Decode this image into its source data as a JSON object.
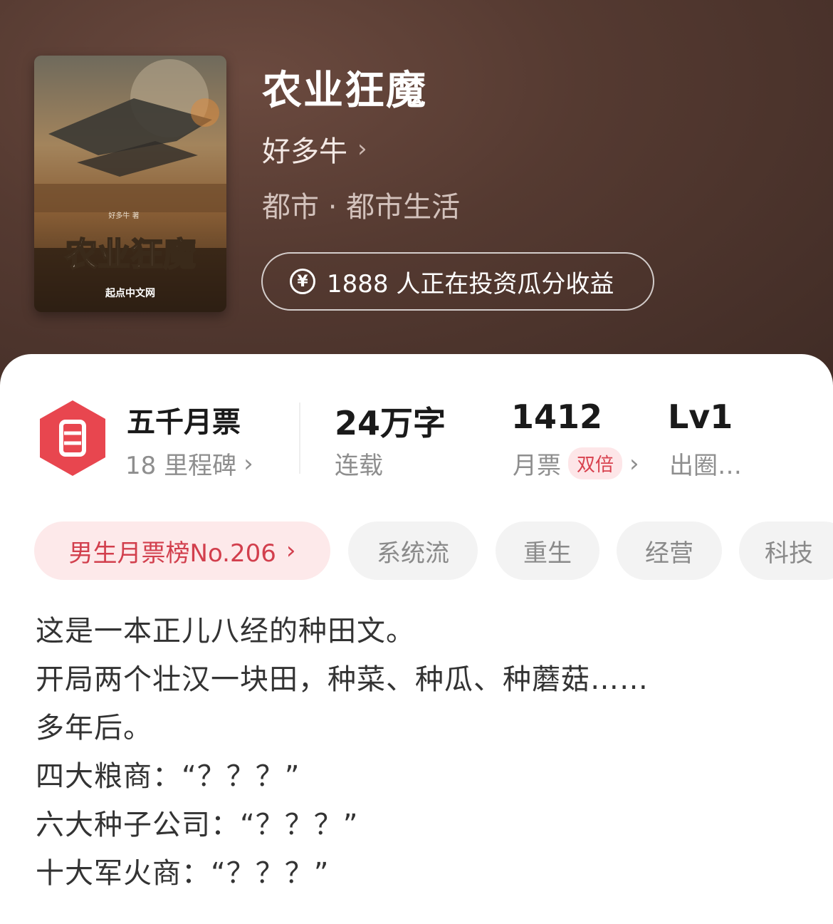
{
  "book": {
    "title": "农业狂魔",
    "author": "好多牛",
    "genre": "都市 · 都市生活",
    "invest_text": "1888 人正在投资瓜分收益",
    "cover": {
      "title": "农业狂魔",
      "author_tag": "好多牛 著",
      "publisher": "起点中文网"
    }
  },
  "stats": {
    "badge": {
      "title": "五千月票",
      "sub": "18 里程碑"
    },
    "words": {
      "title": "24万字",
      "sub": "连载"
    },
    "tickets": {
      "title": "1412",
      "sub": "月票",
      "double": "双倍"
    },
    "level": {
      "title": "Lv1",
      "sub": "出圈…"
    }
  },
  "tags": {
    "rank": "男生月票榜No.206",
    "items": [
      "系统流",
      "重生",
      "经营",
      "科技"
    ]
  },
  "description": [
    "这是一本正儿八经的种田文。",
    "开局两个壮汉一块田，种菜、种瓜、种蘑菇……",
    "多年后。",
    "四大粮商：“？？？”",
    "六大种子公司：“？？？”",
    "十大军火商：“？？？”"
  ],
  "colors": {
    "accent_red": "#d23f4d",
    "hero_bg": "#553a31"
  }
}
